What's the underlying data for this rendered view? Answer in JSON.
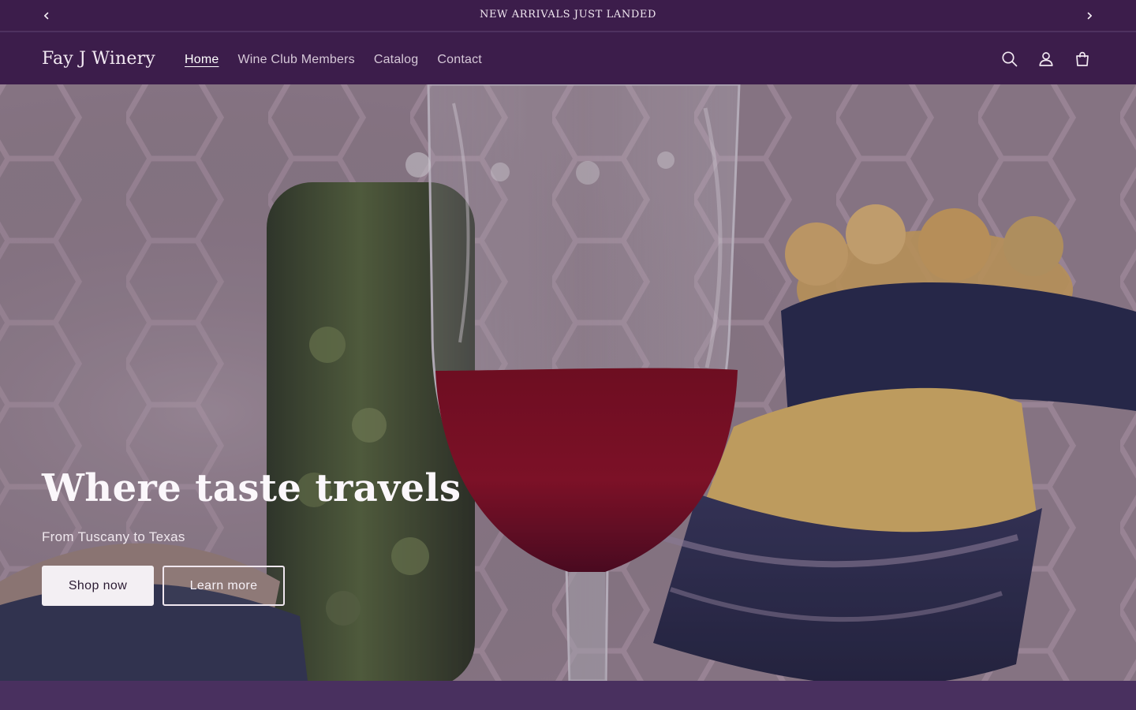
{
  "announcement": {
    "text": "NEW ARRIVALS JUST LANDED",
    "prev_icon": "chevron-left-icon",
    "next_icon": "chevron-right-icon"
  },
  "header": {
    "logo": "Fay J Winery",
    "nav": [
      {
        "label": "Home",
        "active": true
      },
      {
        "label": "Wine Club Members",
        "active": false
      },
      {
        "label": "Catalog",
        "active": false
      },
      {
        "label": "Contact",
        "active": false
      }
    ],
    "icons": [
      "search-icon",
      "account-icon",
      "cart-icon"
    ]
  },
  "hero": {
    "title": "Where taste travels",
    "subtitle": "From Tuscany to Texas",
    "primary_button": "Shop now",
    "secondary_button": "Learn more"
  },
  "theme": {
    "header_bg": "#3c1d4b",
    "footer_band": "#49305f",
    "wine_red": "#8d0d22"
  }
}
